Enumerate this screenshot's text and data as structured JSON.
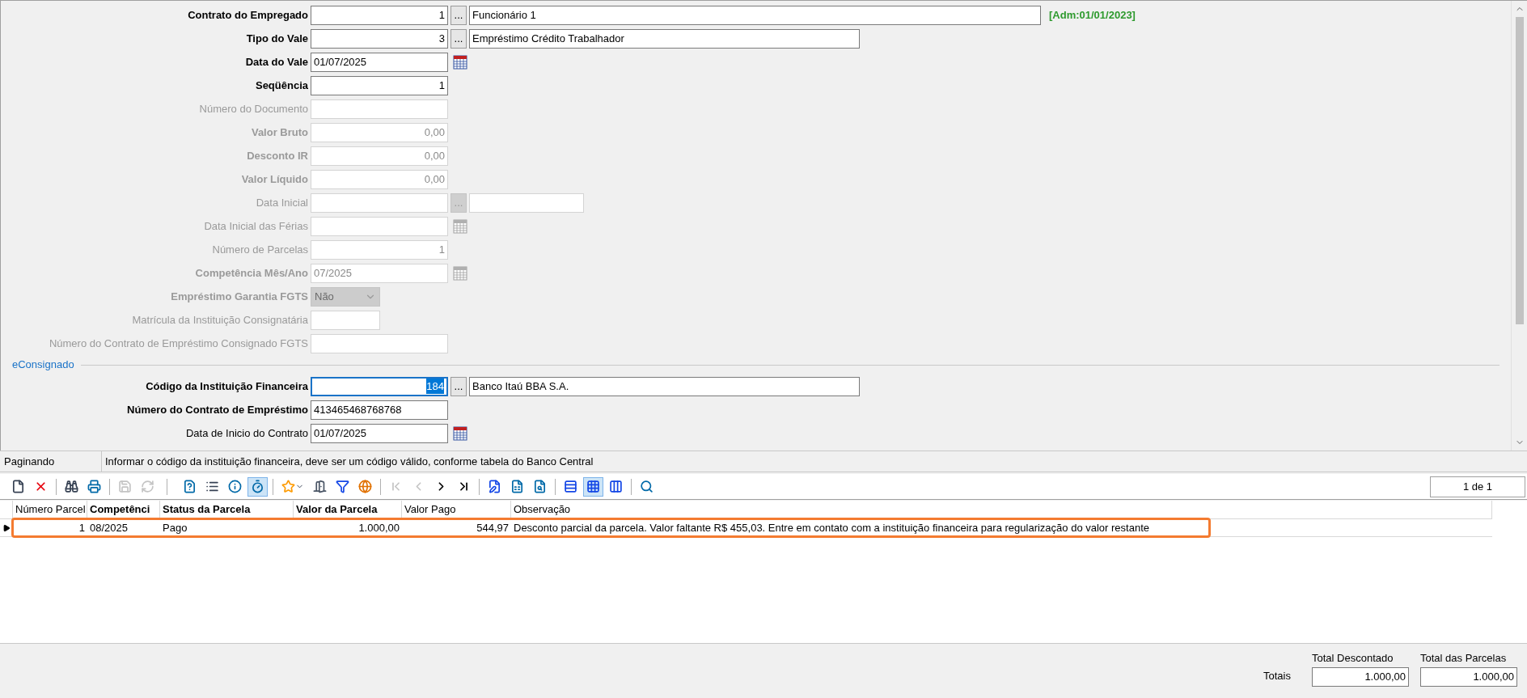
{
  "form": {
    "fields": [
      {
        "label": "Contrato do Empregado",
        "bold": true,
        "disabled": false,
        "kind": "input",
        "narrow": false,
        "numeric": true,
        "value": "1",
        "lookup": {
          "button": "...",
          "disabled": false,
          "description": "Funcionário 1",
          "kind": "long"
        },
        "note": "[Adm:01/01/2023]"
      },
      {
        "label": "Tipo do Vale",
        "bold": true,
        "disabled": false,
        "kind": "input",
        "narrow": false,
        "numeric": true,
        "value": "3",
        "lookup": {
          "button": "...",
          "disabled": false,
          "description": "Empréstimo Crédito Trabalhador",
          "kind": "medium"
        }
      },
      {
        "label": "Data do Vale",
        "bold": true,
        "disabled": false,
        "kind": "input",
        "narrow": false,
        "numeric": false,
        "value": "01/07/2025",
        "calendar": true
      },
      {
        "label": "Seqüência",
        "bold": true,
        "disabled": false,
        "kind": "input",
        "narrow": false,
        "numeric": true,
        "value": "1"
      },
      {
        "label": "Número do Documento",
        "bold": false,
        "disabled": true,
        "kind": "input",
        "narrow": false,
        "numeric": false
      },
      {
        "label": "Valor Bruto",
        "bold": true,
        "disabled": true,
        "kind": "input",
        "narrow": false,
        "numeric": true,
        "value": "0,00"
      },
      {
        "label": "Desconto IR",
        "bold": true,
        "disabled": true,
        "kind": "input",
        "narrow": false,
        "numeric": true,
        "value": "0,00"
      },
      {
        "label": "Valor Líquido",
        "bold": true,
        "disabled": true,
        "kind": "input",
        "narrow": false,
        "numeric": true,
        "value": "0,00"
      },
      {
        "label": "Data Inicial",
        "bold": false,
        "disabled": true,
        "kind": "input",
        "narrow": false,
        "numeric": false,
        "lookup": {
          "button": "...",
          "disabled": true,
          "kind": "short"
        }
      },
      {
        "label": "Data Inicial das Férias",
        "bold": false,
        "disabled": true,
        "kind": "input",
        "narrow": false,
        "numeric": false,
        "calendar": true
      },
      {
        "label": "Número de Parcelas",
        "bold": false,
        "disabled": true,
        "kind": "input",
        "narrow": false,
        "numeric": true,
        "value": "1"
      },
      {
        "label": "Competência Mês/Ano",
        "bold": true,
        "disabled": true,
        "kind": "input",
        "narrow": false,
        "numeric": false,
        "value": "07/2025",
        "calendar": true
      },
      {
        "label": "Empréstimo Garantia FGTS",
        "bold": true,
        "disabled": true,
        "kind": "select",
        "narrow": true,
        "value": "Não"
      },
      {
        "label": "Matrícula da Instituição Consignatária",
        "bold": false,
        "disabled": true,
        "kind": "input",
        "narrow": true,
        "numeric": false
      },
      {
        "label": "Número do Contrato de Empréstimo Consignado FGTS",
        "bold": false,
        "disabled": true,
        "kind": "input",
        "narrow": false,
        "numeric": false
      },
      {
        "kind": "section",
        "label": "eConsignado"
      },
      {
        "label": "Código da Instituição Financeira",
        "bold": true,
        "disabled": false,
        "kind": "input",
        "narrow": false,
        "numeric": true,
        "value": "184",
        "focused": true,
        "lookup": {
          "button": "...",
          "disabled": false,
          "description": "Banco Itaú BBA S.A.",
          "kind": "medium"
        }
      },
      {
        "label": "Número do Contrato de Empréstimo",
        "bold": true,
        "disabled": false,
        "kind": "input",
        "narrow": false,
        "numeric": false,
        "value": "413465468768768"
      },
      {
        "label": "Data de Inicio do Contrato",
        "bold": false,
        "disabled": false,
        "kind": "input",
        "narrow": false,
        "numeric": false,
        "value": "01/07/2025",
        "calendar": true
      }
    ]
  },
  "status_bar": {
    "mode": "Paginando",
    "hint": "Informar o código da instituição financeira, deve ser um código válido, conforme tabela do Banco Central"
  },
  "toolbar": {
    "buttons": [
      {
        "pressed": false,
        "disabled": false
      },
      {
        "pressed": false,
        "disabled": false
      },
      {
        "pressed": false,
        "disabled": false
      },
      {
        "pressed": false,
        "disabled": false
      },
      {
        "pressed": false,
        "disabled": true
      },
      {
        "pressed": false,
        "disabled": true
      },
      {
        "pressed": false,
        "disabled": false
      },
      {
        "pressed": false,
        "disabled": false
      },
      {
        "pressed": false,
        "disabled": false
      },
      {
        "pressed": true,
        "disabled": false
      },
      {
        "pressed": false,
        "disabled": false
      },
      {
        "pressed": false,
        "disabled": false
      },
      {
        "pressed": false,
        "disabled": false
      },
      {
        "pressed": false,
        "disabled": false
      },
      {
        "pressed": false,
        "disabled": true
      },
      {
        "pressed": false,
        "disabled": true
      },
      {
        "pressed": false,
        "disabled": false
      },
      {
        "pressed": false,
        "disabled": false
      },
      {
        "pressed": false,
        "disabled": false
      },
      {
        "pressed": false,
        "disabled": false
      },
      {
        "pressed": false,
        "disabled": false
      },
      {
        "pressed": false,
        "disabled": false
      },
      {
        "pressed": true,
        "disabled": false
      },
      {
        "pressed": false,
        "disabled": false
      },
      {
        "pressed": false,
        "disabled": false
      }
    ],
    "page": "1 de 1"
  },
  "table": {
    "columns": [
      {
        "label": "Número Parcel",
        "bold": false
      },
      {
        "label": "Competênci",
        "bold": true
      },
      {
        "label": "Status da Parcela",
        "bold": true
      },
      {
        "label": "Valor da Parcela",
        "bold": true
      },
      {
        "label": "Valor Pago",
        "bold": false
      },
      {
        "label": "Observação",
        "bold": false
      }
    ],
    "rows": [
      {
        "selected": true,
        "cells": [
          "1",
          "08/2025",
          "Pago",
          "1.000,00",
          "544,97",
          "Desconto parcial da parcela. Valor faltante R$ 455,03. Entre em contato com a instituição financeira para regularização do valor restante"
        ]
      }
    ]
  },
  "totals": {
    "label": "Totais",
    "items": [
      {
        "label": "Total Descontado",
        "value": "1.000,00"
      },
      {
        "label": "Total das Parcelas",
        "value": "1.000,00"
      }
    ]
  }
}
